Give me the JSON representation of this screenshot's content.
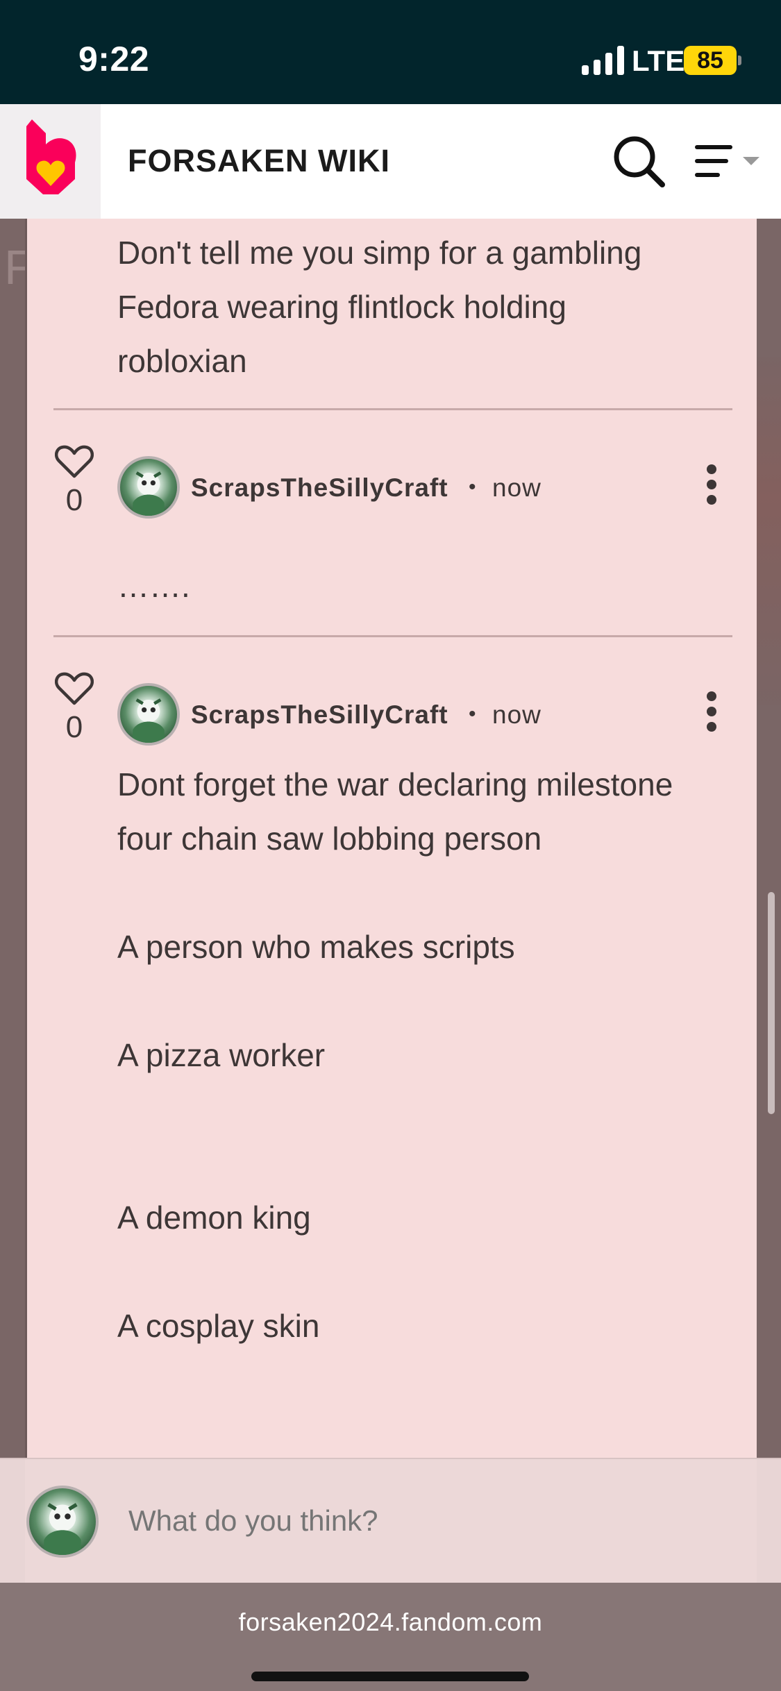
{
  "status_bar": {
    "time": "9:22",
    "network": "LTE",
    "battery": "85",
    "battery_color": "#ffd60a",
    "background": "#02252c"
  },
  "header": {
    "title": "FORSAKEN WIKI",
    "logo_icon": "fandom-heart-flame-icon",
    "search_icon": "search-icon",
    "menu_icon": "menu-icon"
  },
  "comments": [
    {
      "text_lines": [
        "Don't tell me you simp for a gambling",
        "Fedora wearing flintlock holding",
        "robloxian"
      ]
    },
    {
      "likes": "0",
      "username": "ScrapsTheSillyCraft",
      "separator": "•",
      "timestamp": "now",
      "body": "……."
    },
    {
      "likes": "0",
      "username": "ScrapsTheSillyCraft",
      "separator": "•",
      "timestamp": "now",
      "body_lines": [
        "Dont forget the war declaring milestone",
        "four chain saw lobbing person",
        "A person who makes scripts",
        "A pizza worker",
        "A demon king",
        "A cosplay skin"
      ]
    }
  ],
  "composer": {
    "placeholder": "What do you think?"
  },
  "browser": {
    "url": "forsaken2024.fandom.com"
  },
  "colors": {
    "panel": "#f7dcdc",
    "text": "#3d3636",
    "fandom_pink": "#fa005a",
    "fandom_yellow": "#ffc500"
  }
}
